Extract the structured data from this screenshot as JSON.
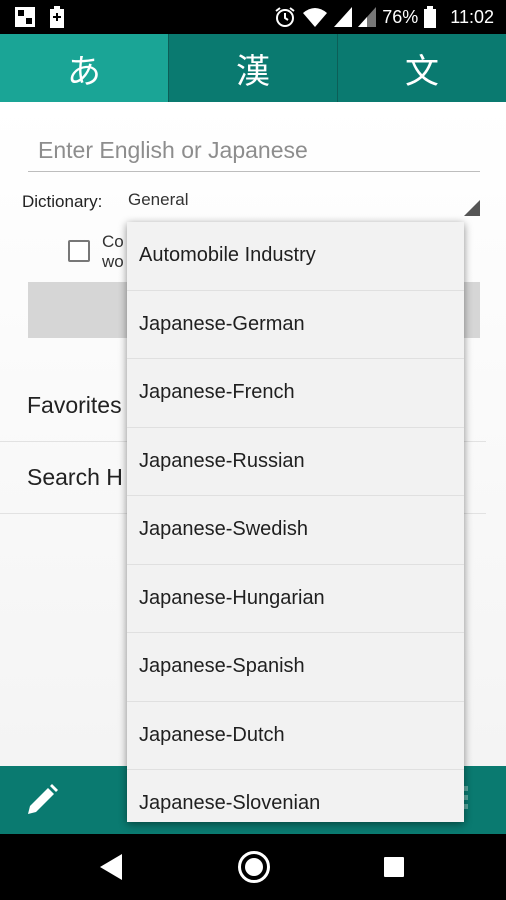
{
  "status_bar": {
    "battery_percent": "76%",
    "time": "11:02"
  },
  "tabs": [
    {
      "label": "あ",
      "active": true
    },
    {
      "label": "漢",
      "active": false
    },
    {
      "label": "文",
      "active": false
    }
  ],
  "search": {
    "placeholder": "Enter English or Japanese",
    "value": ""
  },
  "dictionary": {
    "label": "Dictionary:",
    "selected": "General"
  },
  "checkbox": {
    "label_visible": "Co wo",
    "checked": false
  },
  "menu": {
    "favorites_label": "Favorites",
    "history_label": "Search H"
  },
  "dropdown": {
    "options": [
      "Automobile Industry",
      "Japanese-German",
      "Japanese-French",
      "Japanese-Russian",
      "Japanese-Swedish",
      "Japanese-Hungarian",
      "Japanese-Spanish",
      "Japanese-Dutch",
      "Japanese-Slovenian"
    ]
  },
  "colors": {
    "tab_bar": "#0a7a70",
    "tab_active": "#1aa596",
    "bottom_bar": "#0a7a70"
  },
  "icons": {
    "status_left": [
      "gallery-icon",
      "battery-saver-icon"
    ],
    "status_right": [
      "alarm-icon",
      "wifi-icon",
      "signal-icon",
      "signal-icon-2",
      "battery-icon"
    ],
    "bottom_left": "pencil-icon",
    "nav": [
      "back-icon",
      "home-icon",
      "recents-icon"
    ]
  }
}
